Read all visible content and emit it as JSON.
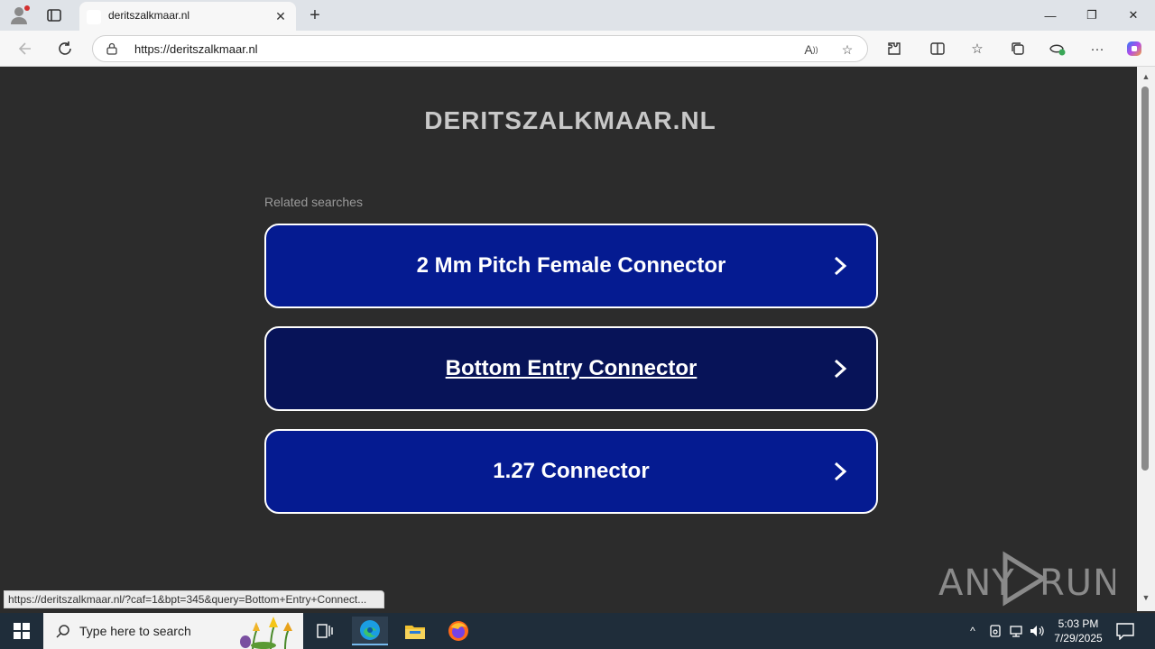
{
  "browser": {
    "tab_title": "deritszalkmaar.nl",
    "tab_close": "✕",
    "new_tab": "+",
    "url": "https://deritszalkmaar.nl",
    "window_controls": {
      "minimize": "—",
      "restore": "❐",
      "close": "✕"
    }
  },
  "page": {
    "site_title": "DERITSZALKMAAR.NL",
    "related_label": "Related searches",
    "results": [
      {
        "label": "2 Mm Pitch Female Connector",
        "hovered": false
      },
      {
        "label": "Bottom Entry Connector",
        "hovered": true
      },
      {
        "label": "1.27 Connector",
        "hovered": false
      }
    ],
    "status_url": "https://deritszalkmaar.nl/?caf=1&bpt=345&query=Bottom+Entry+Connect...",
    "watermark": "ANY RUN"
  },
  "taskbar": {
    "search_placeholder": "Type here to search",
    "time": "5:03 PM",
    "date": "7/29/2025"
  },
  "colors": {
    "page_bg": "#2c2c2c",
    "button_bg": "#051b91",
    "button_hover_bg": "#071358",
    "title_color": "#c8c8c8"
  }
}
